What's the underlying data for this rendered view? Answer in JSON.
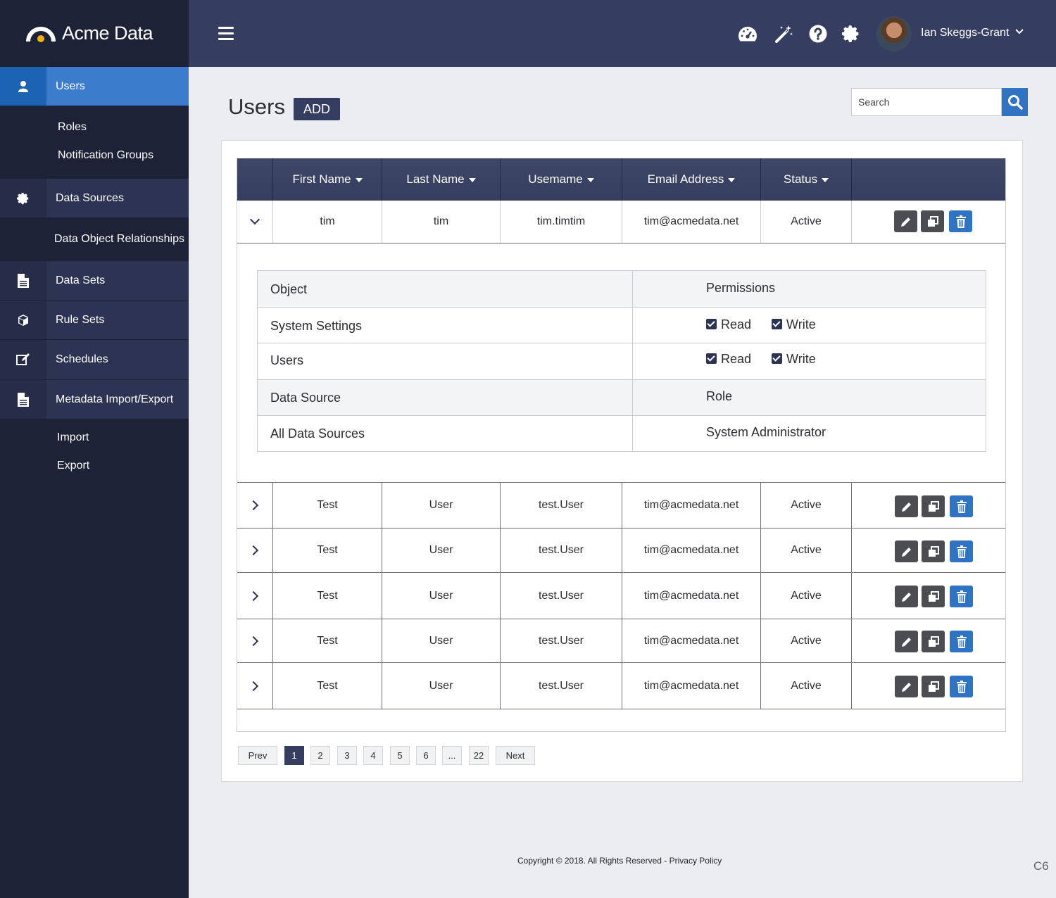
{
  "brand": {
    "name": "Acme Data"
  },
  "sidebar": {
    "items": [
      {
        "label": "Users",
        "icon": "user-icon"
      },
      {
        "label": "Roles"
      },
      {
        "label": "Notification Groups"
      },
      {
        "label": "Data Sources",
        "icon": "gear-icon"
      },
      {
        "label": "Data Object Relationships"
      },
      {
        "label": "Data Sets",
        "icon": "document-icon"
      },
      {
        "label": "Rule Sets",
        "icon": "cube-icon"
      },
      {
        "label": "Schedules",
        "icon": "edit-icon"
      },
      {
        "label": "Metadata Import/Export",
        "icon": "document-icon"
      },
      {
        "label": "Import"
      },
      {
        "label": "Export"
      }
    ]
  },
  "topbar": {
    "icons": [
      "dashboard-icon",
      "magic-wand-icon",
      "help-icon",
      "gear-icon"
    ],
    "user_name": "Ian Skeggs-Grant"
  },
  "page": {
    "title": "Users",
    "add_label": "ADD",
    "search_placeholder": "Search"
  },
  "table": {
    "headers": [
      "First Name",
      "Last Name",
      "Usemame",
      "Email Address",
      "Status"
    ],
    "expanded_row": {
      "first": "tim",
      "last": "tim",
      "username": "tim.timtim",
      "email": "tim@acmedata.net",
      "status": "Active"
    },
    "permissions": {
      "object_header": "Object",
      "permissions_header": "Permissions",
      "rows": [
        {
          "object": "System Settings",
          "read": "Read",
          "write": "Write"
        },
        {
          "object": "Users",
          "read": "Read",
          "write": "Write"
        }
      ],
      "source_header": "Data Source",
      "role_header": "Role",
      "source_value": "All Data Sources",
      "role_value": "System Administrator"
    },
    "rows": [
      {
        "first": "Test",
        "last": "User",
        "username": "test.User",
        "email": "tim@acmedata.net",
        "status": "Active"
      },
      {
        "first": "Test",
        "last": "User",
        "username": "test.User",
        "email": "tim@acmedata.net",
        "status": "Active"
      },
      {
        "first": "Test",
        "last": "User",
        "username": "test.User",
        "email": "tim@acmedata.net",
        "status": "Active"
      },
      {
        "first": "Test",
        "last": "User",
        "username": "test.User",
        "email": "tim@acmedata.net",
        "status": "Active"
      },
      {
        "first": "Test",
        "last": "User",
        "username": "test.User",
        "email": "tim@acmedata.net",
        "status": "Active"
      }
    ]
  },
  "pagination": {
    "prev": "Prev",
    "pages": [
      "1",
      "2",
      "3",
      "4",
      "5",
      "6",
      "...",
      "22"
    ],
    "next": "Next",
    "current": "1"
  },
  "footer": {
    "text": "Copyright © 2018. All Rights Reserved - Privacy Policy"
  },
  "corner_label": "C6",
  "colors": {
    "sidebar": "#1d2236",
    "topbar": "#353d60",
    "accent": "#2f73c2"
  }
}
